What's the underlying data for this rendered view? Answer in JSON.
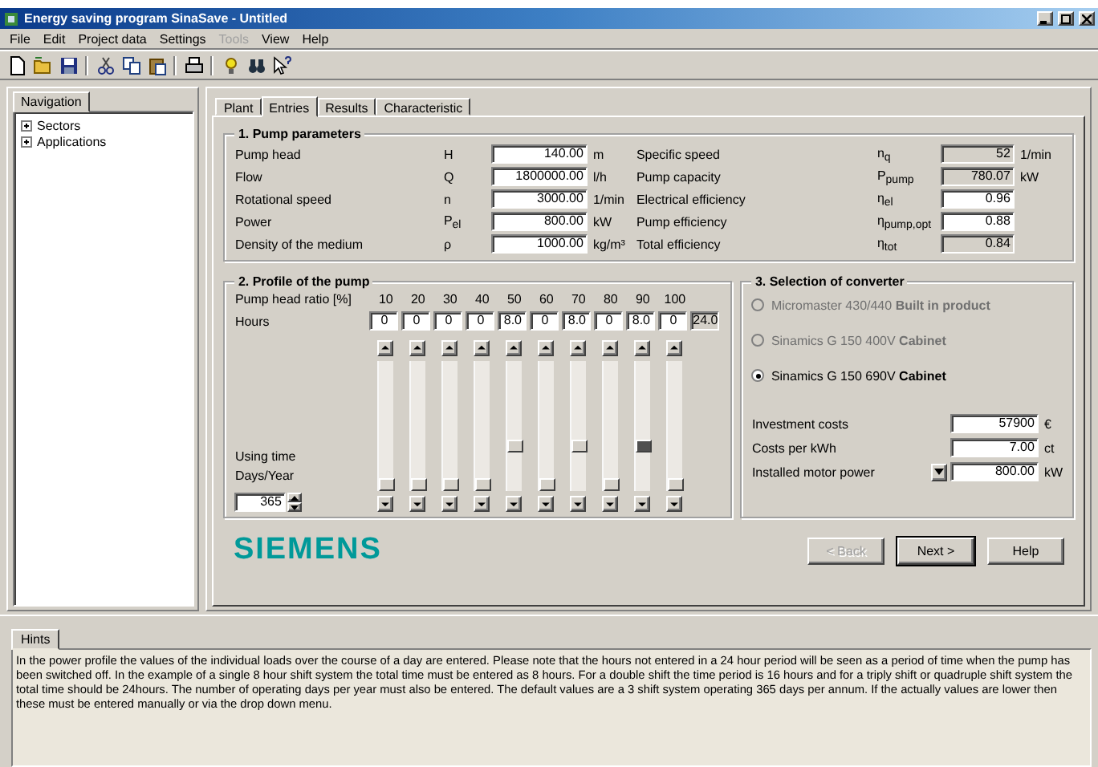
{
  "window": {
    "title": "Energy saving program SinaSave - Untitled"
  },
  "menu": [
    {
      "label": "File",
      "disabled": false
    },
    {
      "label": "Edit",
      "disabled": false
    },
    {
      "label": "Project data",
      "disabled": false
    },
    {
      "label": "Settings",
      "disabled": false
    },
    {
      "label": "Tools",
      "disabled": true
    },
    {
      "label": "View",
      "disabled": false
    },
    {
      "label": "Help",
      "disabled": false
    }
  ],
  "navigation": {
    "tab": "Navigation",
    "items": [
      {
        "label": "Sectors",
        "expanded": false
      },
      {
        "label": "Applications",
        "expanded": false
      }
    ]
  },
  "tabs": [
    {
      "label": "Plant",
      "selected": false
    },
    {
      "label": "Entries",
      "selected": true
    },
    {
      "label": "Results",
      "selected": false
    },
    {
      "label": "Characteristic",
      "selected": false
    }
  ],
  "pump_parameters": {
    "title": "1. Pump parameters",
    "left": [
      {
        "label": "Pump head",
        "symbol": "H",
        "value": "140.00",
        "unit": "m"
      },
      {
        "label": "Flow",
        "symbol": "Q",
        "value": "1800000.00",
        "unit": "l/h"
      },
      {
        "label": "Rotational speed",
        "symbol": "n",
        "value": "3000.00",
        "unit": "1/min"
      },
      {
        "label": "Power",
        "symbol": "P$_{el}$",
        "value": "800.00",
        "unit": "kW"
      },
      {
        "label": "Density of the medium",
        "symbol": "ρ",
        "value": "1000.00",
        "unit": "kg/m³"
      }
    ],
    "right": [
      {
        "label": "Specific speed",
        "symbol": "n$_{q}$",
        "value": "52",
        "unit": "1/min",
        "readonly": true
      },
      {
        "label": "Pump capacity",
        "symbol": "P$_{pump}$",
        "value": "780.07",
        "unit": "kW",
        "readonly": true
      },
      {
        "label": "Electrical efficiency",
        "symbol": "η$_{el}$",
        "value": "0.96",
        "readonly": false
      },
      {
        "label": "Pump efficiency",
        "symbol": "η$_{pump,opt}$",
        "value": "0.88",
        "readonly": false
      },
      {
        "label": "Total efficiency",
        "symbol": "η$_{tot}$",
        "value": "0.84",
        "readonly": true
      }
    ]
  },
  "profile": {
    "title": "2. Profile of the pump",
    "ratio_label": "Pump head ratio [%]",
    "hours_label": "Hours",
    "ratios": [
      "10",
      "20",
      "30",
      "40",
      "50",
      "60",
      "70",
      "80",
      "90",
      "100"
    ],
    "hours": [
      {
        "value": "0",
        "level": 0,
        "focused": false
      },
      {
        "value": "0",
        "level": 0,
        "focused": false
      },
      {
        "value": "0",
        "level": 0,
        "focused": false
      },
      {
        "value": "0",
        "level": 0,
        "focused": false
      },
      {
        "value": "8.0",
        "level": 0.333,
        "focused": false
      },
      {
        "value": "0",
        "level": 0,
        "focused": false
      },
      {
        "value": "8.0",
        "level": 0.333,
        "focused": false
      },
      {
        "value": "0",
        "level": 0,
        "focused": false
      },
      {
        "value": "8.0",
        "level": 0.333,
        "focused": true
      },
      {
        "value": "0",
        "level": 0,
        "focused": false
      }
    ],
    "total": "24.0",
    "using_time_label": "Using time",
    "days_label": "Days/Year",
    "days": "365"
  },
  "converter": {
    "title": "3. Selection of converter",
    "options": [
      {
        "text": "Micromaster 430/440 **Built in product**",
        "selected": false,
        "disabled": true
      },
      {
        "text": "Sinamics G 150 400V **Cabinet**",
        "selected": false,
        "disabled": true
      },
      {
        "text": "Sinamics G 150 690V **Cabinet**",
        "selected": true,
        "disabled": false
      }
    ],
    "fields": [
      {
        "kind": "text",
        "label": "Investment costs",
        "value": "57900",
        "unit": "€"
      },
      {
        "kind": "text",
        "label": "Costs per kWh",
        "value": "7.00",
        "unit": "ct"
      },
      {
        "kind": "dropdown",
        "label": "Installed motor power",
        "value": "800.00",
        "unit": "kW"
      }
    ]
  },
  "logo": "SIEMENS",
  "buttons": [
    {
      "label": "< Back",
      "disabled": true,
      "default": false
    },
    {
      "label": "Next >",
      "disabled": false,
      "default": true
    },
    {
      "label": "Help",
      "disabled": false,
      "default": false
    }
  ],
  "hints": {
    "tab": "Hints",
    "text": "In the power profile the values of the individual loads over the course of a day are entered. Please note that the hours not entered in a 24 hour period will be seen as a period of time when the pump has been switched off. In the example of a single 8 hour shift system the total time must be entered as 8 hours. For a double shift the time period is 16 hours and for a triply shift or quadruple shift system the total time should be 24hours. The number of operating days per year must also be entered. The default values are a 3 shift system operating 365 days per annum. If the actually values are lower then these must be entered manually or via the drop down menu."
  }
}
